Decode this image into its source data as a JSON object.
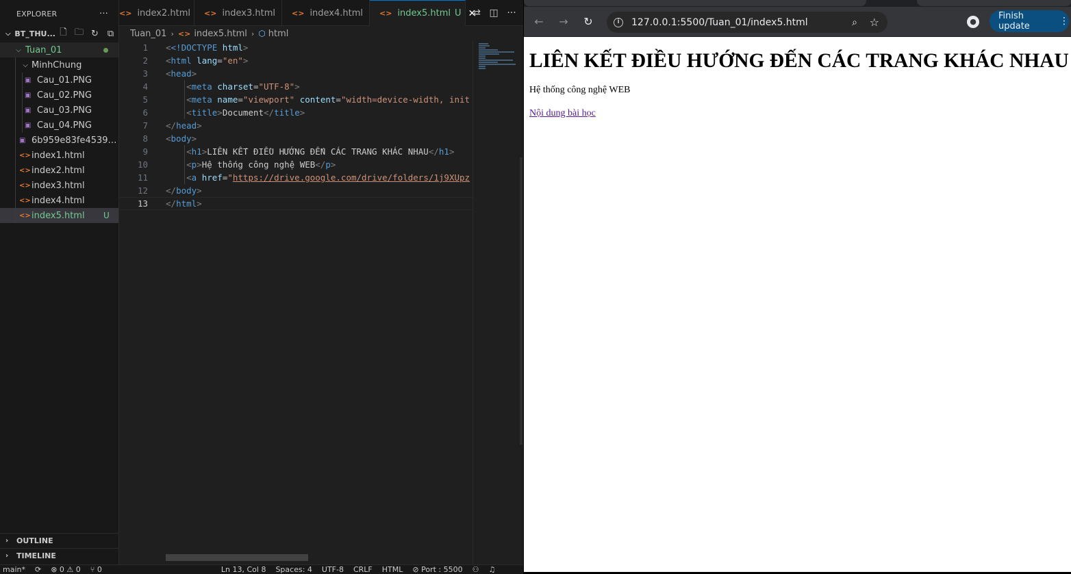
{
  "explorer": {
    "title": "EXPLORER",
    "more": "···",
    "workspace": "BT_THU...",
    "folder": "Tuan_01",
    "subfolder": "MinhChung",
    "files": [
      {
        "name": "Cau_01.PNG",
        "type": "img"
      },
      {
        "name": "Cau_02.PNG",
        "type": "img"
      },
      {
        "name": "Cau_03.PNG",
        "type": "img"
      },
      {
        "name": "Cau_04.PNG",
        "type": "img"
      }
    ],
    "root_files": [
      {
        "name": "6b959e83fe45390ae...",
        "type": "img"
      },
      {
        "name": "index1.html",
        "type": "html"
      },
      {
        "name": "index2.html",
        "type": "html"
      },
      {
        "name": "index3.html",
        "type": "html"
      },
      {
        "name": "index4.html",
        "type": "html"
      }
    ],
    "active_file": "index5.html",
    "active_status": "U",
    "outline": "OUTLINE",
    "timeline": "TIMELINE"
  },
  "tabs": [
    {
      "label": "index2.html"
    },
    {
      "label": "index3.html"
    },
    {
      "label": "index4.html"
    },
    {
      "label": "index5.html",
      "status": "U"
    }
  ],
  "breadcrumb": {
    "folder": "Tuan_01",
    "file": "index5.html",
    "symbol": "html"
  },
  "code": {
    "line_numbers": [
      "1",
      "2",
      "3",
      "4",
      "5",
      "6",
      "7",
      "8",
      "9",
      "10",
      "11",
      "12",
      "13"
    ],
    "doctype": "<!DOCTYPE",
    "doctype_kw": "html",
    "lang_val": "\"en\"",
    "charset_val": "\"UTF-8\"",
    "viewport_val": "\"viewport\"",
    "content_val": "\"width=device-width, init",
    "title_text": "Document",
    "h1_text": "LIÊN KẾT ĐIỀU HƯỚNG ĐẾN CÁC TRANG KHÁC NHAU",
    "p_text": "Hệ thống công nghệ WEB",
    "href_val": "https://drive.google.com/drive/folders/1j9XUpz"
  },
  "statusbar": {
    "branch": "main*",
    "sync": "⟳",
    "problems": "⊗ 0 ⚠ 0",
    "ports": "⑂ 0",
    "position": "Ln 13, Col 8",
    "spaces": "Spaces: 4",
    "encoding": "UTF-8",
    "eol": "CRLF",
    "language": "HTML",
    "port": "⊘ Port : 5500"
  },
  "browser": {
    "url": "127.0.0.1:5500/Tuan_01/index5.html",
    "finish_update": "Finish update",
    "page": {
      "heading": "LIÊN KẾT ĐIỀU HƯỚNG ĐẾN CÁC TRANG KHÁC NHAU",
      "paragraph": "Hệ thống công nghệ WEB",
      "link": "Nội dung bài học"
    }
  }
}
